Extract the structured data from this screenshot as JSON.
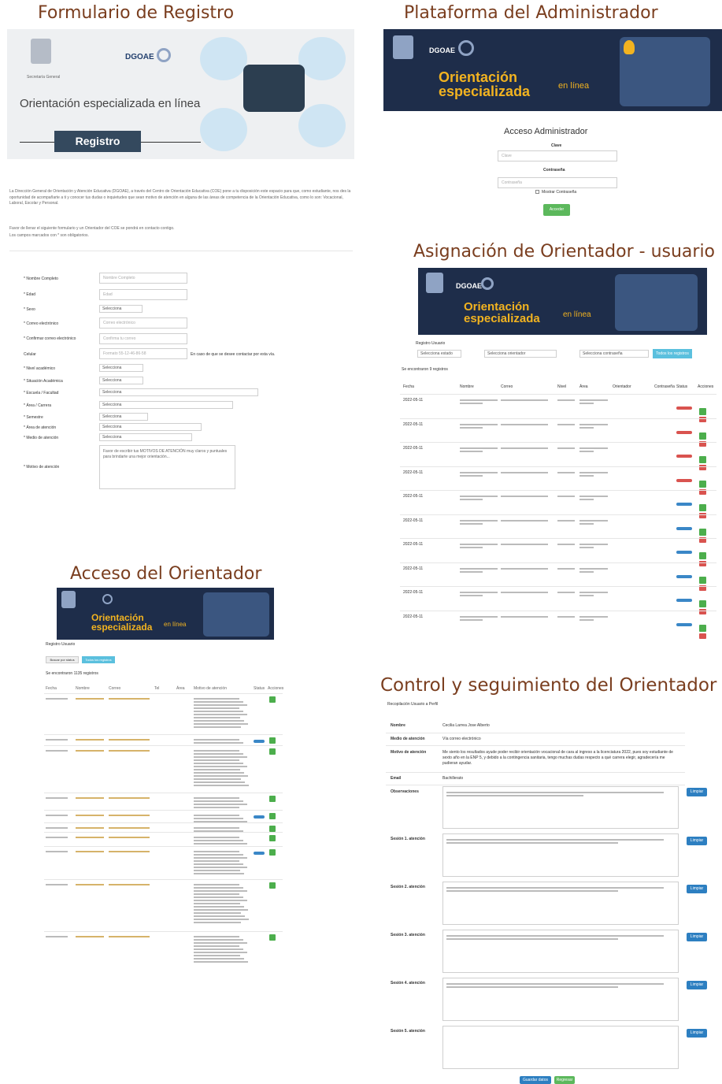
{
  "registro": {
    "title": "Formulario de Registro",
    "banner_org": "Secretaría General",
    "banner_dgoae": "DGOAE",
    "banner_subtitle": "Orientación especializada en línea",
    "banner_button": "Registro",
    "intro": "La Dirección General de Orientación y Atención Educativa (DGOAE), a través del Centro de Orientación Educativa (COE) pone a tu disposición este espacio para que, como estudiante, nos des la oportunidad de acompañarte a ti y conocer tus dudas o inquietudes que sean motivo de atención en alguna de las áreas de competencia de la Orientación Educativa, como lo son: Vocacional, Laboral, Escolar y Personal.",
    "intro2": "Favor de llenar el siguiente formulario y un Orientador del COE se pondrá en contacto contigo.",
    "intro3": "Los campos marcados con * son obligatorios.",
    "fields": [
      {
        "label": "* Nombre Completo",
        "value": "Nombre Completo"
      },
      {
        "label": "* Edad",
        "value": "Edad"
      },
      {
        "label": "* Sexo",
        "value": "Selecciona"
      },
      {
        "label": "* Correo electrónico",
        "value": "Correo electrónico"
      },
      {
        "label": "* Confirmar correo electrónico",
        "value": "Confirma tu correo"
      },
      {
        "label": "Celular",
        "value": "Formato 55-12-46-86-58"
      },
      {
        "label": "* Nivel académico",
        "value": "Selecciona"
      },
      {
        "label": "* Situación Académica",
        "value": "Selecciona"
      },
      {
        "label": "* Escuela / Facultad",
        "value": "Selecciona"
      },
      {
        "label": "* Área / Carrera",
        "value": "Selecciona"
      },
      {
        "label": "* Semestre",
        "value": "Selecciona"
      },
      {
        "label": "* Área de atención",
        "value": "Selecciona"
      },
      {
        "label": "* Medio de atención",
        "value": "Selecciona"
      },
      {
        "label": "* Motivo de atención",
        "value": "Favor de escribir tus MOTIVOS DE ATENCIÓN muy claros y puntuales para brindarte una mejor orientación..."
      }
    ],
    "celular_note": "En caso de que se desee contactar por esta vía."
  },
  "admin": {
    "title": "Plataforma del Administrador",
    "banner_dgoae": "DGOAE",
    "banner_line1": "Orientación",
    "banner_line2": "especializada",
    "banner_enl": "en línea",
    "login_title": "Acceso Administrador",
    "user_label": "Clave",
    "user_placeholder": "Clave",
    "pass_label": "Contraseña",
    "pass_placeholder": "Contraseña",
    "show_pass": "Mostrar Contraseña",
    "submit": "Acceder"
  },
  "asignacion": {
    "title": "Asignación de Orientador - usuario",
    "banner_dgoae": "DGOAE",
    "banner_line1": "Orientación",
    "banner_line2": "especializada",
    "banner_enl": "en línea",
    "subhead": "Registro Usuario",
    "filter1": "Selecciona estado",
    "filter2": "Selecciona orientador",
    "filter3": "Selecciona contraseña",
    "filter_btn": "Todos los registros",
    "count": "Se encontraron 9 registros",
    "columns": [
      "Fecha",
      "Nombre",
      "Correo",
      "Nivel",
      "Área",
      "Orientador",
      "Contraseña",
      "Status",
      "Acciones"
    ],
    "rows": [
      {
        "fecha": "2022-05-11",
        "status": "r"
      },
      {
        "fecha": "2022-05-11",
        "status": "r"
      },
      {
        "fecha": "2022-05-11",
        "status": "r"
      },
      {
        "fecha": "2022-05-11",
        "status": "r"
      },
      {
        "fecha": "2022-05-11",
        "status": "b"
      },
      {
        "fecha": "2022-05-11",
        "status": "b"
      },
      {
        "fecha": "2022-05-11",
        "status": "b"
      },
      {
        "fecha": "2022-05-11",
        "status": "b"
      },
      {
        "fecha": "2022-05-11",
        "status": "b"
      },
      {
        "fecha": "2022-05-11",
        "status": "b"
      }
    ]
  },
  "orientador": {
    "title": "Acceso del Orientador",
    "banner_line1": "Orientación",
    "banner_line2": "especializada",
    "banner_enl": "en línea",
    "subhead": "Registro Usuario",
    "tab1": "Buscar por status",
    "tab2": "Todos los registros",
    "count": "Se encontraron 1135 registros",
    "columns": [
      "Fecha",
      "Nombre",
      "Correo",
      "Tel",
      "Área",
      "Motivo de atención",
      "Status",
      "Acciones"
    ]
  },
  "control": {
    "title": "Control y seguimiento del Orientador",
    "subhead": "Recopilación Usuario a Perfil",
    "nombre_label": "Nombre",
    "nombre_value": "Cecilia Larrea Jose Alberto",
    "medio_label": "Medio de atención",
    "medio_value": "Vía correo electrónico",
    "motivo_label": "Motivo de atención",
    "motivo_value": "Me siento los resultados ayude poder recibir orientación vocacional de cara al ingreso a la licenciatura 2022, pues soy estudiante de sexto año en la ENP 5, y debido a la contingencia sanitaria, tengo muchas dudas respecto a qué carrera elegir, agradecería me pudieran ayudar.",
    "email_label": "Email",
    "email_value": "Bachillerato",
    "obs_label": "Observaciones",
    "sessions": [
      "Sesión 1. atención",
      "Sesión 2. atención",
      "Sesión 3. atención",
      "Sesión 4. atención",
      "Sesión 5. atención"
    ],
    "save_label": "Limpiar",
    "btn_save": "Guardar datos",
    "btn_back": "Regresar"
  }
}
